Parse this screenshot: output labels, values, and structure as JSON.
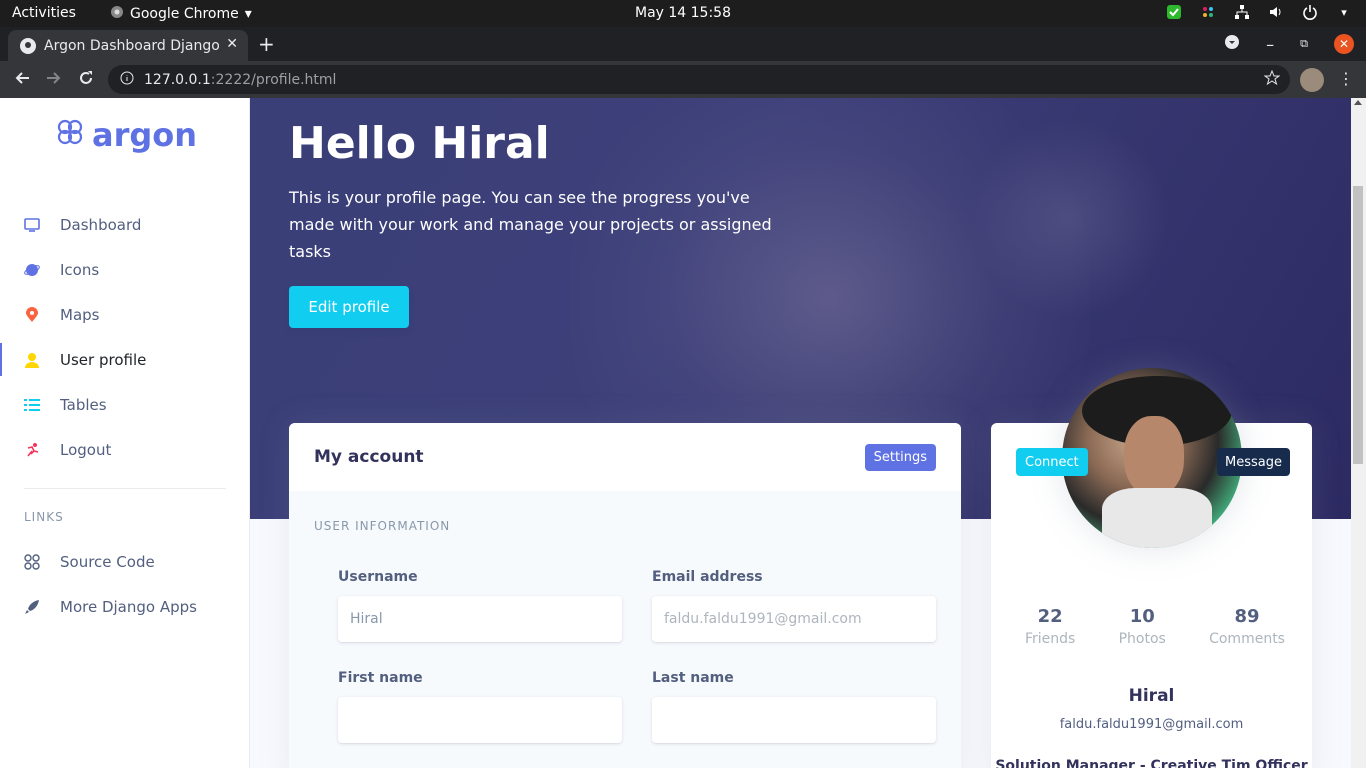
{
  "os": {
    "activities": "Activities",
    "app_name": "Google Chrome",
    "clock": "May 14  15:58"
  },
  "browser": {
    "tab_title": "Argon Dashboard Django",
    "url_host": "127.0.0.1",
    "url_path": ":2222/profile.html"
  },
  "sidebar": {
    "brand": "argon",
    "items": [
      {
        "label": "Dashboard",
        "icon": "tv-icon"
      },
      {
        "label": "Icons",
        "icon": "planet-icon"
      },
      {
        "label": "Maps",
        "icon": "pin-icon"
      },
      {
        "label": "User profile",
        "icon": "user-icon"
      },
      {
        "label": "Tables",
        "icon": "list-icon"
      },
      {
        "label": "Logout",
        "icon": "running-icon"
      }
    ],
    "links_heading": "LINKS",
    "links": [
      {
        "label": "Source Code",
        "icon": "code-icon"
      },
      {
        "label": "More Django Apps",
        "icon": "rocket-icon"
      }
    ]
  },
  "header": {
    "greeting": "Hello Hiral",
    "intro": "This is your profile page. You can see the progress you've made with your work and manage your projects or assigned tasks",
    "edit_button": "Edit profile"
  },
  "account": {
    "title": "My account",
    "settings_button": "Settings",
    "section": "USER INFORMATION",
    "fields": {
      "username_label": "Username",
      "username_value": "Hiral",
      "email_label": "Email address",
      "email_placeholder": "faldu.faldu1991@gmail.com",
      "first_label": "First name",
      "last_label": "Last name"
    }
  },
  "profile": {
    "connect": "Connect",
    "message": "Message",
    "stats": [
      {
        "value": "22",
        "label": "Friends"
      },
      {
        "value": "10",
        "label": "Photos"
      },
      {
        "value": "89",
        "label": "Comments"
      }
    ],
    "name": "Hiral",
    "email": "faldu.faldu1991@gmail.com",
    "role": "Solution Manager - Creative Tim Officer"
  },
  "colors": {
    "primary": "#5e72e4",
    "info": "#11cdef",
    "default": "#172b4d",
    "header": "#3a3f78"
  }
}
